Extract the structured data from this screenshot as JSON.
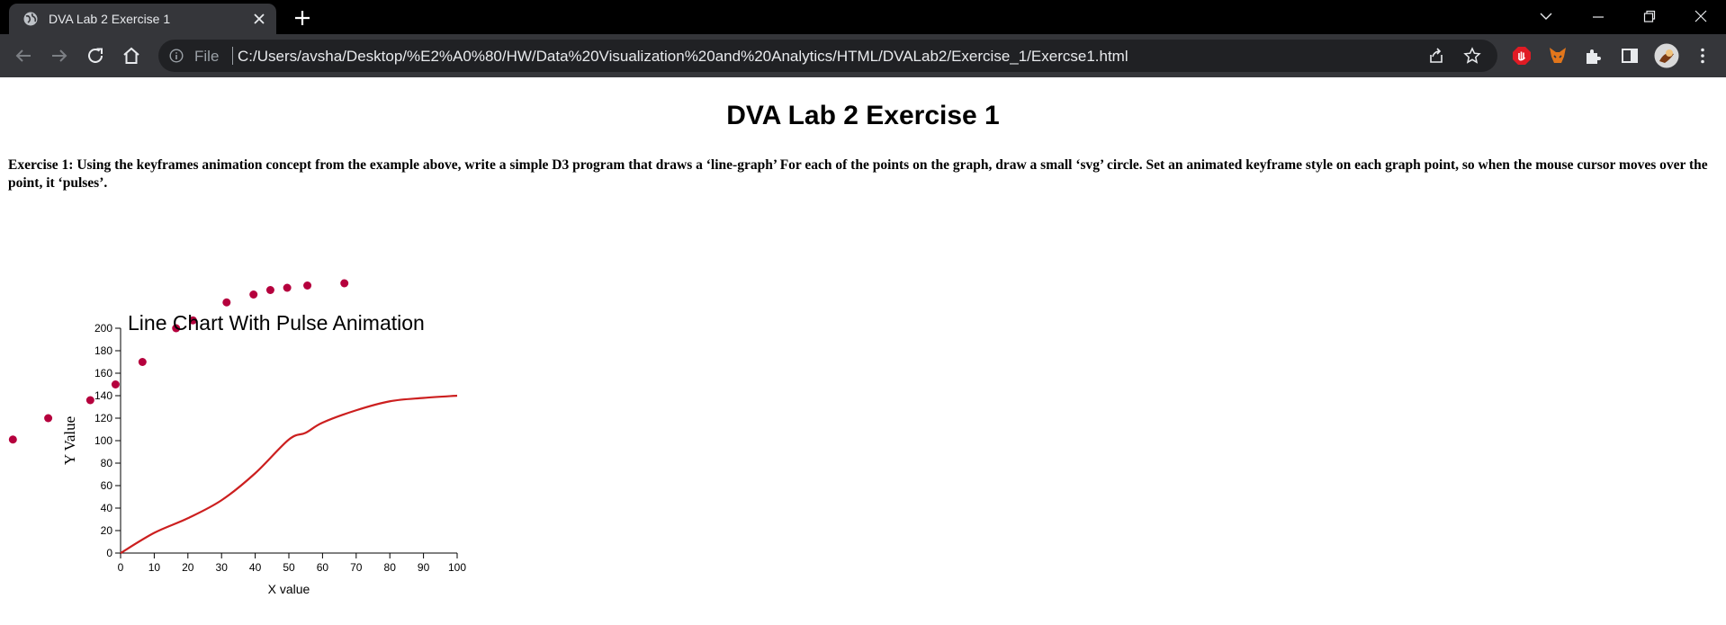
{
  "browser": {
    "tab_title": "DVA Lab 2 Exercise 1",
    "file_label": "File",
    "url": "C:/Users/avsha/Desktop/%E2%A0%80/HW/Data%20Visualization%20and%20Analytics/HTML/DVALab2/Exercise_1/Exercse1.html"
  },
  "page": {
    "title": "DVA Lab 2 Exercise 1",
    "exercise_text": "Exercise 1: Using the keyframes animation concept from the example above, write a simple D3 program that draws a ‘line-graph’ For each of the points on the graph, draw a small ‘svg’ circle. Set an animated keyframe style on each graph point, so when the mouse cursor moves over the point, it ‘pulses’."
  },
  "colors": {
    "line": "#cc1f1f",
    "dots": "#b5003d",
    "tabbar": "#000000",
    "toolbar": "#35363a",
    "omnibox": "#202124"
  },
  "chart_data": {
    "type": "line",
    "title": "Line Chart With Pulse Animation",
    "xlabel": "X value",
    "ylabel": "Y Value",
    "xlim": [
      0,
      100
    ],
    "ylim": [
      0,
      200
    ],
    "x_ticks": [
      0,
      10,
      20,
      30,
      40,
      50,
      60,
      70,
      80,
      90,
      100
    ],
    "y_ticks": [
      0,
      20,
      40,
      60,
      80,
      100,
      120,
      140,
      160,
      180,
      200
    ],
    "line_points": [
      {
        "x": 0,
        "y": 0
      },
      {
        "x": 10,
        "y": 18
      },
      {
        "x": 20,
        "y": 31
      },
      {
        "x": 30,
        "y": 47
      },
      {
        "x": 40,
        "y": 71
      },
      {
        "x": 50,
        "y": 101
      },
      {
        "x": 55,
        "y": 107
      },
      {
        "x": 60,
        "y": 116
      },
      {
        "x": 70,
        "y": 127
      },
      {
        "x": 80,
        "y": 135
      },
      {
        "x": 90,
        "y": 138
      },
      {
        "x": 100,
        "y": 140
      }
    ],
    "points": [
      {
        "x": -32,
        "y": 101
      },
      {
        "x": -21.5,
        "y": 120
      },
      {
        "x": -9,
        "y": 136
      },
      {
        "x": -1.5,
        "y": 150
      },
      {
        "x": 6.5,
        "y": 170
      },
      {
        "x": 16.5,
        "y": 200
      },
      {
        "x": 21.5,
        "y": 207
      },
      {
        "x": 31.5,
        "y": 223
      },
      {
        "x": 39.5,
        "y": 230
      },
      {
        "x": 44.5,
        "y": 234
      },
      {
        "x": 49.5,
        "y": 236
      },
      {
        "x": 55.5,
        "y": 238
      },
      {
        "x": 66.5,
        "y": 240
      }
    ]
  }
}
